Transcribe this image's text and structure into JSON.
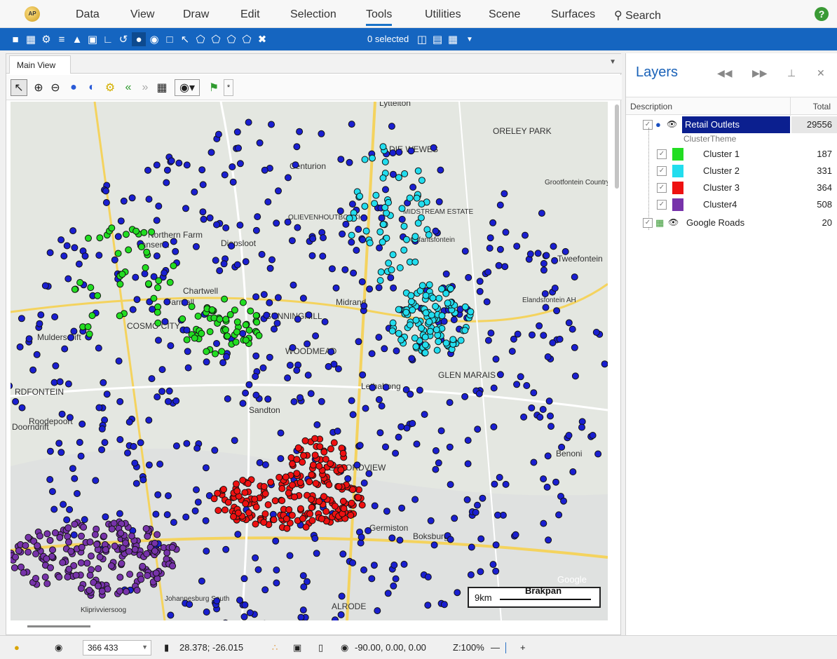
{
  "menu": {
    "items": [
      "Data",
      "View",
      "Draw",
      "Edit",
      "Selection",
      "Tools",
      "Utilities",
      "Scene",
      "Surfaces"
    ],
    "search_label": "Search",
    "active": "Tools"
  },
  "toolbar": {
    "selected_text": "0 selected"
  },
  "tab": {
    "label": "Main View"
  },
  "map": {
    "places": [
      "Centurion",
      "Lyttelton",
      "DIE WEWES",
      "ORELEY PARK",
      "Grootfontein Country Estate",
      "MIDSTREAM ESTATE",
      "OLIEVENHOUTBOSCH",
      "Olifantsfontein",
      "Northern Farm",
      "Lanseria",
      "Diepsloot",
      "Chartwell",
      "Farmall",
      "COSMO CITY",
      "Muldersdrift",
      "Midrand",
      "SUNNINGHILL",
      "WOODMEAD",
      "Elandsfontein AH",
      "Lethabong",
      "GLEN MARAIS",
      "Sandton",
      "Roodepoort",
      "Benoni",
      "BEDFORDVIEW",
      "Germiston",
      "Boksburg",
      "Johannesburg South",
      "Kliprivviersoog",
      "ALRODE",
      "Tweefontein",
      "RDFONTEIN",
      "Doorndrift"
    ],
    "scale_label": "9km",
    "scale_town": "Brakpan",
    "watermark": "Google"
  },
  "layers": {
    "title": "Layers",
    "col_description": "Description",
    "col_total": "Total",
    "rows": [
      {
        "name": "Retail Outlets",
        "total": "29556"
      },
      {
        "name": "ClusterTheme",
        "total": ""
      },
      {
        "name": "Cluster 1",
        "total": "187",
        "color": "#22dd22"
      },
      {
        "name": "Cluster 2",
        "total": "331",
        "color": "#22ddee"
      },
      {
        "name": "Cluster 3",
        "total": "364",
        "color": "#ee1111"
      },
      {
        "name": "Cluster4",
        "total": "508",
        "color": "#7733aa"
      },
      {
        "name": "Google Roads",
        "total": "20"
      }
    ]
  },
  "status": {
    "zoom_field": "366 433",
    "coordinates": "28.378; -26.015",
    "rotation": "-90.00, 0.00, 0.00",
    "zoom": "Z:100%"
  }
}
